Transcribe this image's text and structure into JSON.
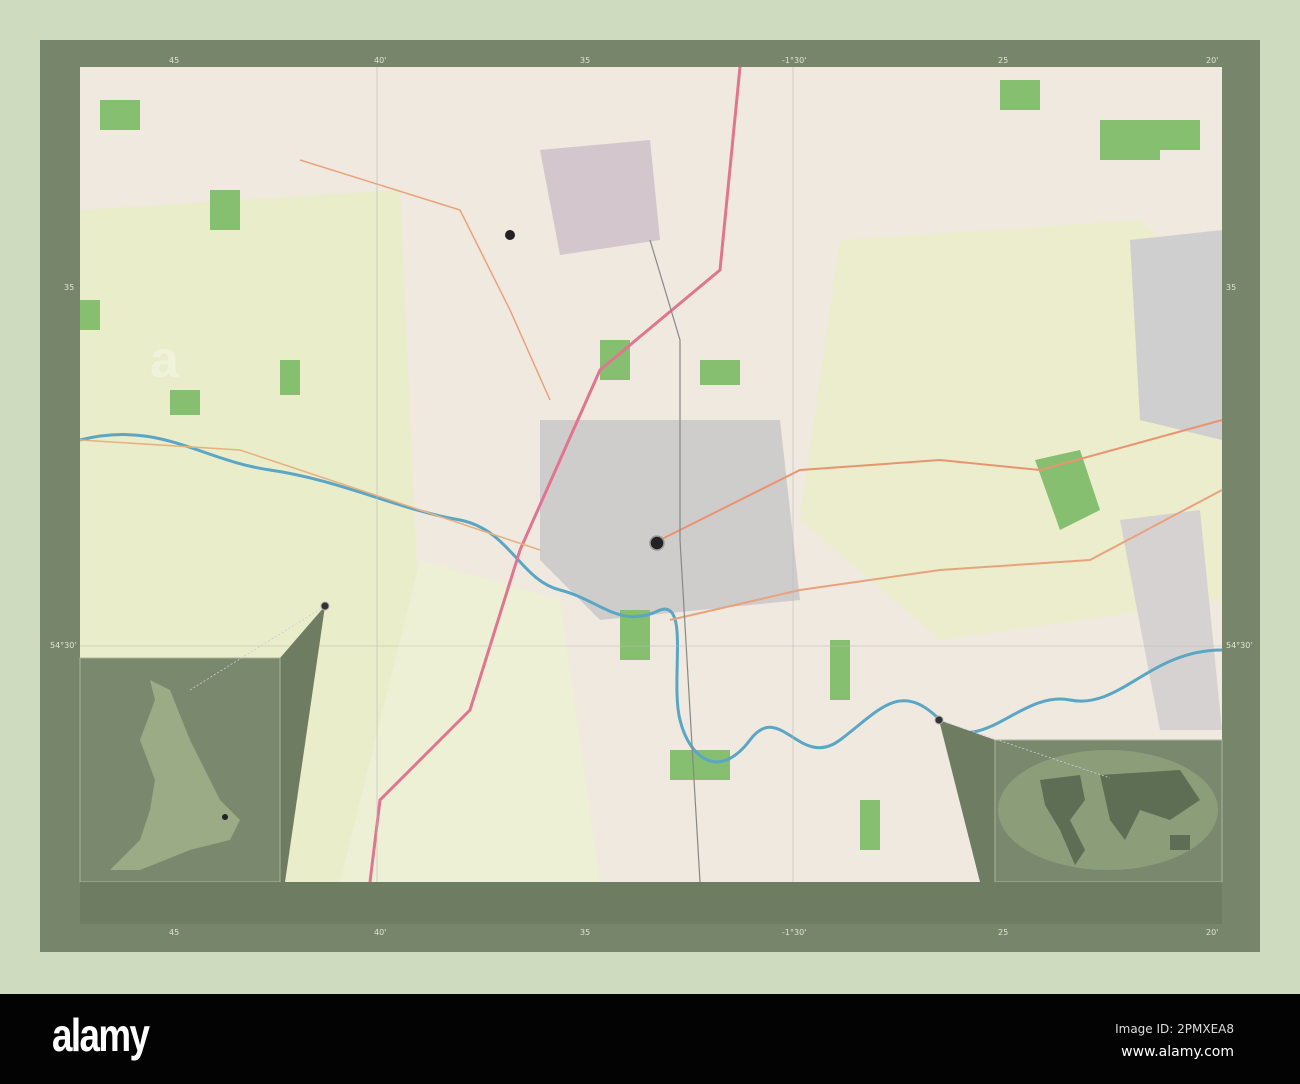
{
  "map": {
    "top_labels": [
      "45",
      "40'",
      "35",
      "-1°30'",
      "25",
      "20'"
    ],
    "bottom_labels": [
      "45",
      "40'",
      "35",
      "-1°30'",
      "25",
      "20'"
    ],
    "left_labels": [
      "35",
      "54°30'"
    ],
    "right_labels": [
      "35",
      "54°30'"
    ],
    "colors": {
      "frame": "#77856a",
      "land": "#efe9df",
      "fields": "#eaedcb",
      "woods": "#7fbb6a",
      "motorway": "#e0708a",
      "primary": "#e8a070",
      "river": "#4e9fc0",
      "urban": "#c9c3c3",
      "inset": "#6e7d62"
    },
    "markers": [
      "location-marker-main",
      "location-marker-secondary"
    ],
    "insets": [
      {
        "name": "England overview"
      },
      {
        "name": "World overview"
      }
    ]
  },
  "watermark": {
    "logo": "alamy",
    "image_id": "Image ID: 2PMXEA8",
    "site": "www.alamy.com"
  }
}
